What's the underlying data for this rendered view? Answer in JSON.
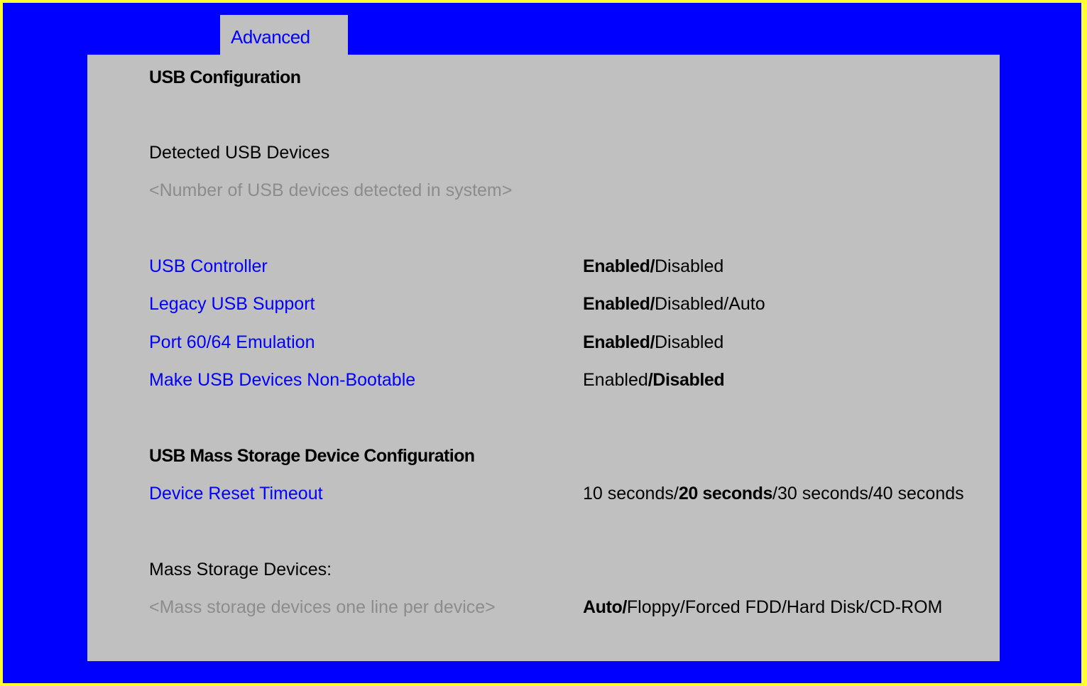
{
  "tab": {
    "label": "Advanced"
  },
  "page": {
    "title": "USB Configuration",
    "detected_label": "Detected USB Devices",
    "detected_help": "<Number of USB devices detected in system>",
    "mass_storage_heading": "USB Mass Storage Device Configuration",
    "mass_storage_devices_label": "Mass Storage Devices:",
    "mass_storage_help": "<Mass storage devices one line per device>"
  },
  "settings": [
    {
      "label": "USB Controller",
      "options": [
        {
          "text": "Enabled",
          "default": true
        },
        {
          "text": "/",
          "default": true
        },
        {
          "text": "Disabled",
          "default": false
        }
      ]
    },
    {
      "label": "Legacy USB Support",
      "options": [
        {
          "text": "Enabled",
          "default": true
        },
        {
          "text": "/",
          "default": true
        },
        {
          "text": "Disabled/Auto",
          "default": false
        }
      ]
    },
    {
      "label": "Port 60/64 Emulation",
      "options": [
        {
          "text": "Enabled",
          "default": true
        },
        {
          "text": "/",
          "default": true
        },
        {
          "text": "Disabled",
          "default": false
        }
      ]
    },
    {
      "label": "Make USB Devices Non-Bootable",
      "options": [
        {
          "text": "Enabled",
          "default": false
        },
        {
          "text": "/Disabled",
          "default": true
        }
      ]
    },
    {
      "label": "Device Reset Timeout",
      "options": [
        {
          "text": "10 seconds/",
          "default": false
        },
        {
          "text": "20 seconds",
          "default": true
        },
        {
          "text": "/30 seconds/40 seconds",
          "default": false
        }
      ]
    }
  ],
  "mass_storage_value": {
    "options": [
      {
        "text": "Auto/",
        "default": true
      },
      {
        "text": "Floppy/Forced FDD/Hard Disk/CD-ROM",
        "default": false
      }
    ]
  },
  "colors": {
    "border": "#ffff33",
    "background": "#0000ff",
    "panel": "#c0c0c0",
    "link": "#0000ff",
    "help": "#8c8c8c"
  }
}
